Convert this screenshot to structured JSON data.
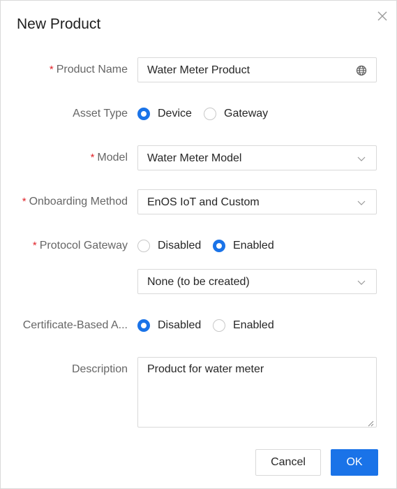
{
  "dialog": {
    "title": "New Product",
    "close_icon": "close-icon"
  },
  "form": {
    "required_mark": "*",
    "product_name": {
      "label": "Product Name",
      "value": "Water Meter Product",
      "icon": "globe-icon"
    },
    "asset_type": {
      "label": "Asset Type",
      "options": [
        "Device",
        "Gateway"
      ],
      "selected": "Device"
    },
    "model": {
      "label": "Model",
      "value": "Water Meter Model",
      "icon": "chevron-down-icon"
    },
    "onboarding_method": {
      "label": "Onboarding Method",
      "value": "EnOS IoT and Custom",
      "icon": "chevron-down-icon"
    },
    "protocol_gateway": {
      "label": "Protocol Gateway",
      "options": [
        "Disabled",
        "Enabled"
      ],
      "selected": "Enabled",
      "select_value": "None (to be created)"
    },
    "certificate_auth": {
      "label": "Certificate-Based A...",
      "options": [
        "Disabled",
        "Enabled"
      ],
      "selected": "Disabled"
    },
    "description": {
      "label": "Description",
      "value": "Product for water meter"
    }
  },
  "buttons": {
    "cancel": "Cancel",
    "ok": "OK"
  },
  "colors": {
    "accent": "#1a73e8",
    "required": "#e0242a"
  }
}
